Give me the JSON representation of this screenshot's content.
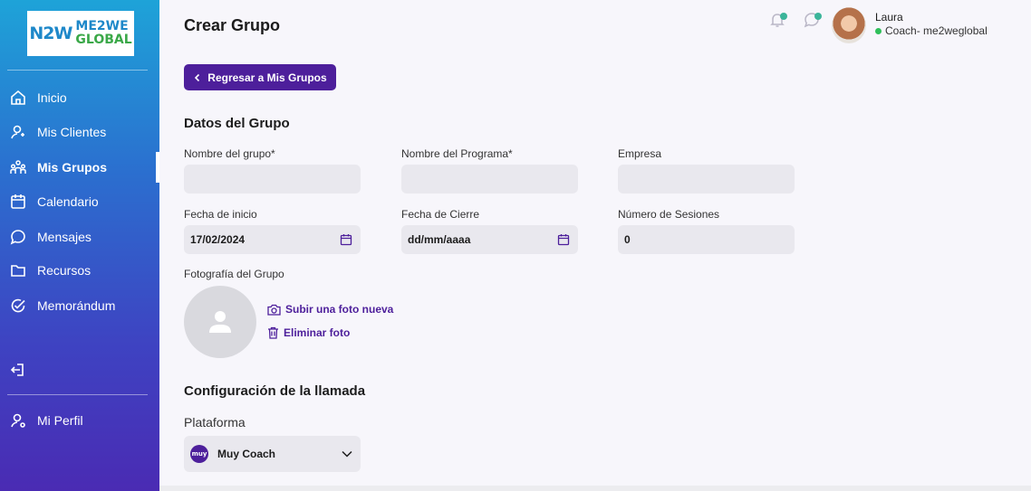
{
  "logo": {
    "mark": "N2W",
    "line1": "ME2WE",
    "line2": "GLOBAL"
  },
  "sidebar": {
    "items": [
      {
        "label": "Inicio",
        "icon": "home-icon"
      },
      {
        "label": "Mis Clientes",
        "icon": "user-icon"
      },
      {
        "label": "Mis Grupos",
        "icon": "users-group-icon",
        "active": true
      },
      {
        "label": "Calendario",
        "icon": "calendar-icon"
      },
      {
        "label": "Mensajes",
        "icon": "chat-icon"
      },
      {
        "label": "Recursos",
        "icon": "folder-icon"
      },
      {
        "label": "Memorándum",
        "icon": "check-circle-icon"
      }
    ],
    "profile": {
      "label": "Mi Perfil",
      "icon": "user-settings-icon"
    },
    "logout_icon": "logout-icon"
  },
  "header": {
    "title": "Crear Grupo",
    "user": {
      "name": "Laura",
      "role": "Coach- me2weglobal"
    }
  },
  "back_button": {
    "label": "Regresar a Mis Grupos"
  },
  "group_data": {
    "title": "Datos del Grupo",
    "group_name": {
      "label": "Nombre del grupo*",
      "value": ""
    },
    "program_name": {
      "label": "Nombre del Programa*",
      "value": ""
    },
    "company": {
      "label": "Empresa",
      "value": ""
    },
    "start_date": {
      "label": "Fecha de inicio",
      "value": "17/02/2024"
    },
    "end_date": {
      "label": "Fecha de Cierre",
      "value": "dd/mm/aaaa"
    },
    "sessions": {
      "label": "Número de Sesiones",
      "value": "0"
    },
    "photo": {
      "label": "Fotografía del Grupo",
      "upload": "Subir una foto nueva",
      "delete": "Eliminar foto"
    }
  },
  "call_config": {
    "title": "Configuración de la llamada",
    "platform_label": "Plataforma",
    "platform_value": "Muy Coach",
    "platform_logo": "muy"
  },
  "colors": {
    "accent": "#4d1f9b",
    "online": "#2fbf5a",
    "notify": "#3bb59a"
  }
}
